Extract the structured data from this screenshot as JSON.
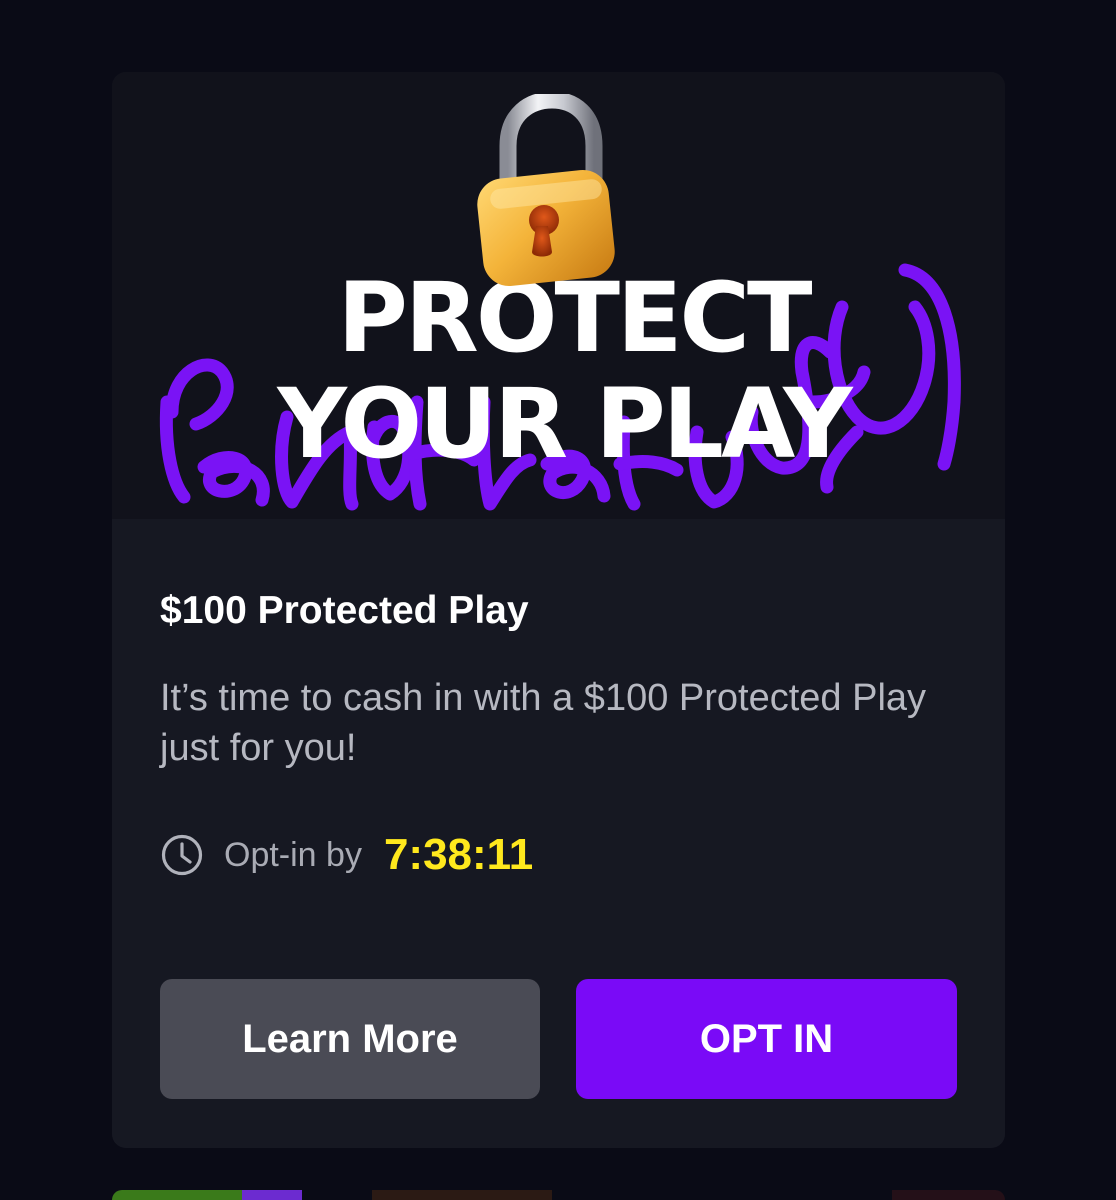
{
  "hero": {
    "headline_line1": "PROTECT",
    "headline_line2": "YOUR PLAY",
    "accent_color": "#7a13f5"
  },
  "offer": {
    "title": "$100 Protected Play",
    "description": "It’s time to cash in with a $100 Protected Play just for you!",
    "deadline_label": "Opt-in by",
    "countdown": "7:38:11",
    "countdown_color": "#ffe81d"
  },
  "actions": {
    "learn_more_label": "Learn More",
    "opt_in_label": "OPT IN",
    "opt_in_color": "#7a0af7",
    "learn_more_color": "#4a4b55"
  },
  "icons": {
    "lock": "lock-icon",
    "clock": "clock-icon"
  }
}
